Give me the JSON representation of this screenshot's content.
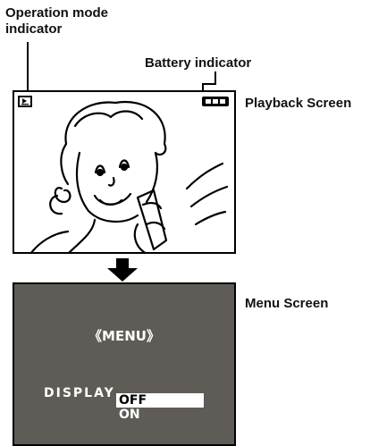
{
  "callouts": {
    "operation_mode": "Operation mode indicator",
    "battery": "Battery indicator",
    "playback_screen": "Playback Screen",
    "menu_screen": "Menu Screen"
  },
  "playback": {
    "mode_icon": "playback-icon",
    "battery_icon": "battery-full-icon"
  },
  "menu": {
    "title": "《MENU》",
    "item": "DISPLAY",
    "options": [
      "OFF",
      "ON"
    ],
    "selected": "OFF",
    "background_color": "#5f5c57"
  }
}
